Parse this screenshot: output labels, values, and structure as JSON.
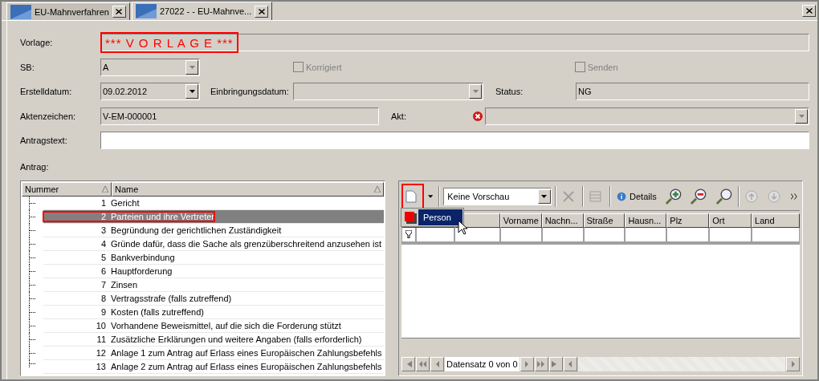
{
  "tabs": [
    {
      "label": "EU-Mahnverfahren",
      "selected": false
    },
    {
      "label": "27022 -  - EU-Mahnve...",
      "selected": true
    }
  ],
  "form": {
    "vorlage": {
      "label": "Vorlage:",
      "value": "*** V O R L A G E ***",
      "annotated": true
    },
    "sb": {
      "label": "SB:",
      "value": "A",
      "disabled": true
    },
    "korrigiert": {
      "label": "Korrigiert",
      "checked": false,
      "disabled": true
    },
    "senden": {
      "label": "Senden",
      "checked": false,
      "disabled": true
    },
    "erstelldatum": {
      "label": "Erstelldatum:",
      "value": "09.02.2012"
    },
    "einbringungsdatum": {
      "label": "Einbringungsdatum:",
      "disabled": true
    },
    "status": {
      "label": "Status:",
      "value": "NG"
    },
    "aktenzeichen": {
      "label": "Aktenzeichen:",
      "value": "V-EM-000001"
    },
    "akt": {
      "label": "Akt:",
      "error": true,
      "disabled": true
    },
    "antragstext": {
      "label": "Antragstext:"
    }
  },
  "antrag": {
    "label": "Antrag:",
    "tree": {
      "columns": [
        "Nummer",
        "Name"
      ],
      "rows": [
        {
          "number": "1",
          "name": "Gericht",
          "selected": false,
          "annotated": false
        },
        {
          "number": "2",
          "name": "Parteien und ihre Vertreter",
          "selected": true,
          "annotated": true
        },
        {
          "number": "3",
          "name": "Begründung der gerichtlichen Zuständigkeit",
          "selected": false,
          "annotated": false
        },
        {
          "number": "4",
          "name": "Gründe dafür, dass die Sache als grenzüberschreitend anzusehen ist",
          "selected": false,
          "annotated": false
        },
        {
          "number": "5",
          "name": "Bankverbindung",
          "selected": false,
          "annotated": false
        },
        {
          "number": "6",
          "name": "Hauptforderung",
          "selected": false,
          "annotated": false
        },
        {
          "number": "7",
          "name": "Zinsen",
          "selected": false,
          "annotated": false
        },
        {
          "number": "8",
          "name": "Vertragsstrafe (falls zutreffend)",
          "selected": false,
          "annotated": false
        },
        {
          "number": "9",
          "name": "Kosten (falls zutreffend)",
          "selected": false,
          "annotated": false
        },
        {
          "number": "10",
          "name": "Vorhandene Beweismittel, auf die sich die Forderung stützt",
          "selected": false,
          "annotated": false
        },
        {
          "number": "11",
          "name": "Zusätzliche Erklärungen und weitere Angaben (falls erforderlich)",
          "selected": false,
          "annotated": false
        },
        {
          "number": "12",
          "name": "Anlage 1 zum Antrag auf Erlass eines Europäischen Zahlungsbefehls",
          "selected": false,
          "annotated": false
        },
        {
          "number": "13",
          "name": "Anlage 2 zum Antrag auf Erlass eines Europäischen Zahlungsbefehls",
          "selected": false,
          "annotated": false
        }
      ]
    },
    "grid": {
      "toolbar": {
        "new_annotated": true,
        "preview": "Keine Vorschau",
        "details": "Details"
      },
      "menu": [
        {
          "label": "Person",
          "selected": true
        }
      ],
      "columns": [
        "Vorname",
        "Nachn...",
        "Straße",
        "Hausn...",
        "Plz",
        "Ort",
        "Land"
      ],
      "navigator": "Datensatz 0 von 0"
    }
  }
}
